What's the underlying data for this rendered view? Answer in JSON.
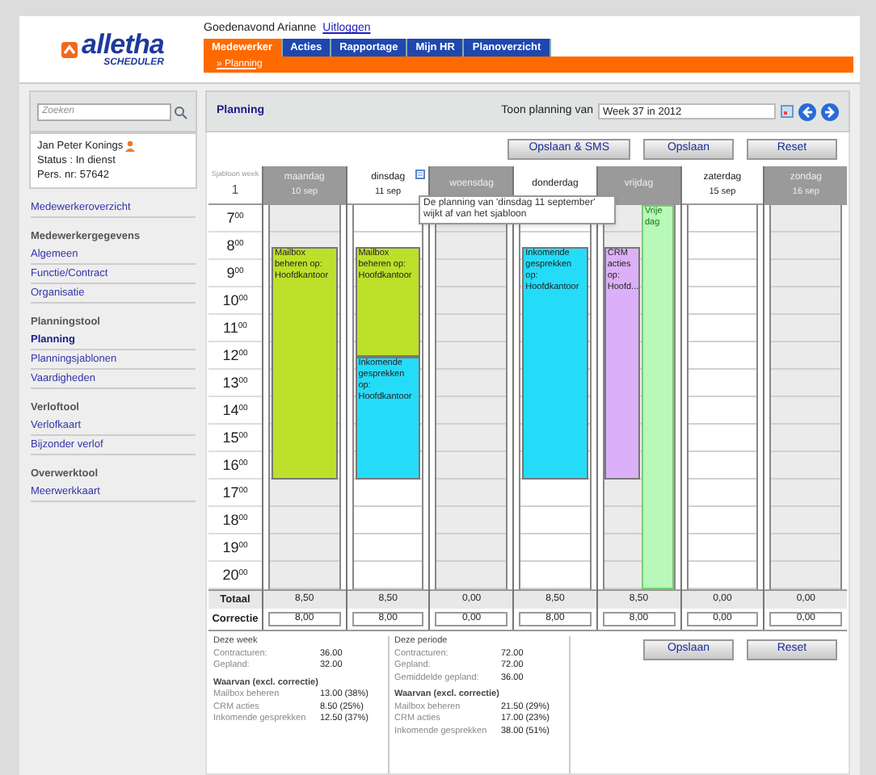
{
  "header": {
    "logo": {
      "name": "alletha",
      "sub": "SCHEDULER"
    },
    "greeting": "Goedenavond Arianne",
    "logout": "Uitloggen",
    "tabs": [
      {
        "label": "Medewerker",
        "selected": true
      },
      {
        "label": "Acties",
        "selected": false
      },
      {
        "label": "Rapportage",
        "selected": false
      },
      {
        "label": "Mijn HR",
        "selected": false
      },
      {
        "label": "Planoverzicht",
        "selected": false
      }
    ],
    "breadcrumb": "» Planning"
  },
  "sidebar": {
    "search": {
      "placeholder": "Zoeken"
    },
    "employee": {
      "name": "Jan Peter Konings",
      "status": "Status : In dienst",
      "number": "Pers. nr: 57642"
    },
    "sections": [
      {
        "items": [
          {
            "label": "Medewerkeroverzicht",
            "selected": false
          }
        ]
      },
      {
        "heading": "Medewerkergegevens",
        "items": [
          {
            "label": "Algemeen",
            "selected": false
          },
          {
            "label": "Functie/Contract",
            "selected": false
          },
          {
            "label": "Organisatie",
            "selected": false
          }
        ]
      },
      {
        "heading": "Planningstool",
        "items": [
          {
            "label": "Planning",
            "selected": true
          },
          {
            "label": "Planningsjablonen",
            "selected": false
          },
          {
            "label": "Vaardigheden",
            "selected": false
          }
        ]
      },
      {
        "heading": "Verloftool",
        "items": [
          {
            "label": "Verlofkaart",
            "selected": false
          },
          {
            "label": "Bijzonder verlof",
            "selected": false
          }
        ]
      },
      {
        "heading": "Overwerktool",
        "items": [
          {
            "label": "Meerwerkkaart",
            "selected": false
          }
        ]
      }
    ]
  },
  "planning": {
    "title": "Planning",
    "week_label": "Toon planning van",
    "week_value": "Week 37 in 2012",
    "buttons": [
      "Opslaan & SMS",
      "Opslaan",
      "Reset"
    ],
    "template": {
      "label": "Sjabloon week",
      "value": "1"
    },
    "hours": [
      "7$^{00}$",
      "8$^{00}$",
      "9$^{00}$",
      "10$^{00}$",
      "11$^{00}$",
      "12$^{00}$",
      "13$^{00}$",
      "14$^{00}$",
      "15$^{00}$",
      "16$^{00}$",
      "17$^{00}$",
      "18$^{00}$",
      "19$^{00}$",
      "20$^{00}$"
    ],
    "days": [
      {
        "name": "maandag",
        "date": "10 sep",
        "deviates": false,
        "total": "8,50",
        "correction": "8,00",
        "events": [
          {
            "kind": "full_shift",
            "text": "Mailbox beheren op: Hoofdkantoor",
            "color": "#bde02a"
          }
        ]
      },
      {
        "name": "dinsdag",
        "date": "11 sep",
        "deviates": true,
        "total": "8,50",
        "correction": "8,00",
        "events": [
          {
            "kind": "morning",
            "text": "Mailbox beheren op: Hoofdkantoor",
            "color": "#bde02a"
          },
          {
            "kind": "afternoon",
            "text": "Inkomende gesprekken op: Hoofdkantoor",
            "color": "#25dcf8"
          }
        ]
      },
      {
        "name": "woensdag",
        "deviates": false,
        "total": "0,00",
        "correction": "0,00"
      },
      {
        "name": "donderdag",
        "deviates": false,
        "total": "8,50",
        "correction": "8,00",
        "events": [
          {
            "kind": "full_shift",
            "text": "Inkomende gesprekken op: Hoofdkantoor",
            "color": "#25dcf8"
          }
        ]
      },
      {
        "name": "vrijdag",
        "deviates": false,
        "total": "8,50",
        "correction": "8,00",
        "events": [
          {
            "kind": "full_shift",
            "text": "CRM acties op: Hoofd...",
            "color": "#dcb0f8"
          },
          {
            "kind": "day_off",
            "text": "Vrije dag",
            "color": "#b8f8b8"
          }
        ]
      },
      {
        "name": "zaterdag",
        "date": "15 sep",
        "deviates": false,
        "total": "0,00",
        "correction": "0,00"
      },
      {
        "name": "zondag",
        "date": "16 sep",
        "deviates": false,
        "total": "0,00",
        "correction": "0,00"
      }
    ],
    "tooltip": "De planning van 'dinsdag 11 september' wijkt af van het sjabloon",
    "total_label": "Totaal",
    "correction_label": "Correctie",
    "stats": [
      {
        "heading": "Deze week",
        "rows": [
          {
            "label": "Contracturen:",
            "value": "36.00"
          },
          {
            "label": "Gepland:",
            "value": "32.00"
          }
        ],
        "sub_heading": "Waarvan (excl. correctie)",
        "breakdown": [
          {
            "label": "Mailbox beheren",
            "value": "13.00 (38%)"
          },
          {
            "label": "CRM acties",
            "value": "8.50 (25%)"
          },
          {
            "label": "Inkomende gesprekken",
            "value": "12.50 (37%)"
          }
        ]
      },
      {
        "heading": "Deze periode",
        "rows": [
          {
            "label": "Contracturen:",
            "value": "72.00"
          },
          {
            "label": "Gepland:",
            "value": "72.00"
          },
          {
            "label": "Gemiddelde gepland:",
            "value": "36.00"
          }
        ],
        "sub_heading": "Waarvan (excl. correctie)",
        "breakdown": [
          {
            "label": "Mailbox beheren",
            "value": "21.50 (29%)"
          },
          {
            "label": "CRM acties",
            "value": "17.00 (23%)"
          },
          {
            "label": "Inkomende gesprekken",
            "value": "38.00 (51%)"
          }
        ]
      }
    ],
    "bottom_buttons": [
      "Opslaan",
      "Reset"
    ]
  }
}
